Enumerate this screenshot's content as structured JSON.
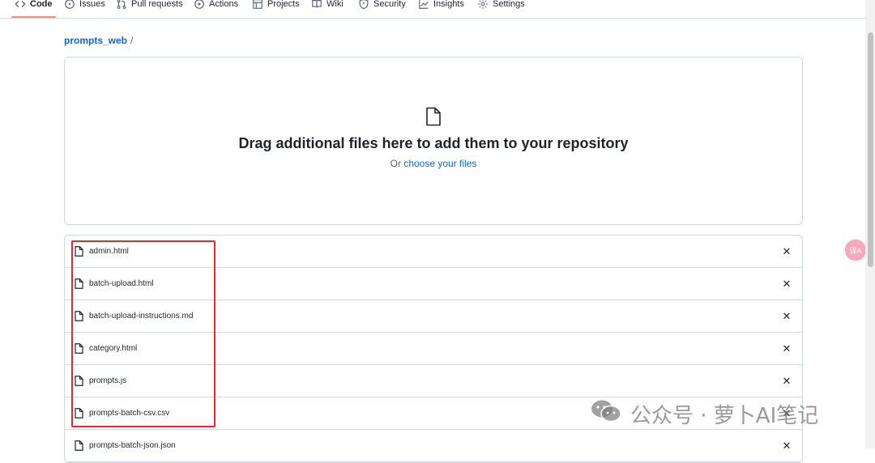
{
  "nav": {
    "tabs": [
      {
        "label": "Code",
        "icon": "code-icon",
        "active": true
      },
      {
        "label": "Issues",
        "icon": "issue-icon"
      },
      {
        "label": "Pull requests",
        "icon": "pull-request-icon"
      },
      {
        "label": "Actions",
        "icon": "play-icon"
      },
      {
        "label": "Projects",
        "icon": "table-icon"
      },
      {
        "label": "Wiki",
        "icon": "book-icon"
      },
      {
        "label": "Security",
        "icon": "shield-icon"
      },
      {
        "label": "Insights",
        "icon": "graph-icon"
      },
      {
        "label": "Settings",
        "icon": "gear-icon"
      }
    ]
  },
  "breadcrumb": {
    "repo": "prompts_web",
    "separator": "/"
  },
  "dropzone": {
    "title": "Drag additional files here to add them to your repository",
    "or_text": "Or",
    "choose_link": "choose your files"
  },
  "files": [
    {
      "name": "admin.html"
    },
    {
      "name": "batch-upload.html"
    },
    {
      "name": "batch-upload-instructions.md"
    },
    {
      "name": "category.html"
    },
    {
      "name": "prompts.js"
    },
    {
      "name": "prompts-batch-csv.csv"
    },
    {
      "name": "prompts-batch-json.json"
    }
  ],
  "close_glyph": "✕",
  "translate_badge": "译A",
  "watermark": {
    "text": "公众号 · 萝卜AI笔记"
  },
  "colors": {
    "accent_link": "#0969da",
    "active_tab_underline": "#fd8c73",
    "highlight_box": "#e0282e",
    "border": "#d1d9e0"
  }
}
